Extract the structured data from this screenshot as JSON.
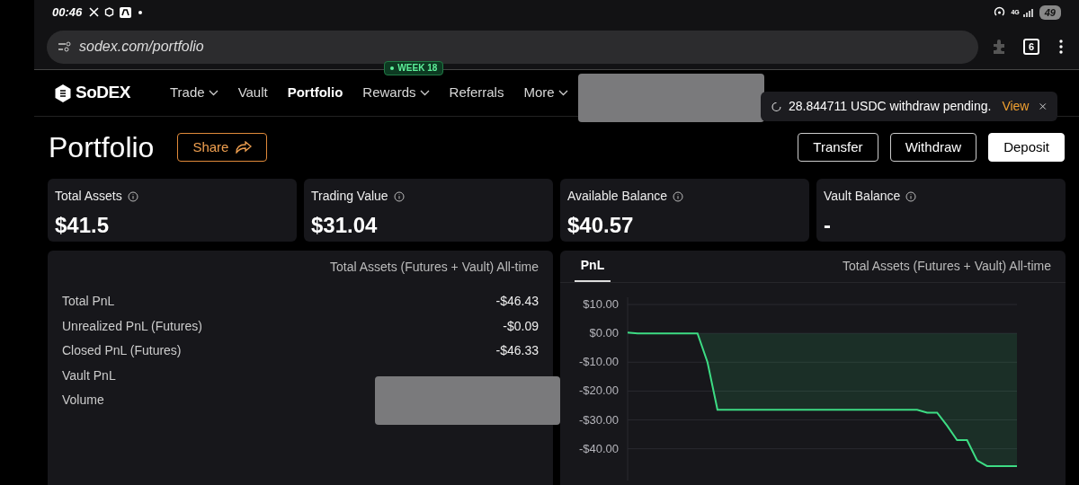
{
  "status_bar": {
    "time": "00:46",
    "network": "4G",
    "battery": "49"
  },
  "browser": {
    "url": "sodex.com/portfolio",
    "tab_count": "6"
  },
  "nav": {
    "logo": "SoDEX",
    "items": [
      {
        "label": "Trade",
        "selected": false,
        "dropdown": true
      },
      {
        "label": "Vault",
        "selected": false,
        "dropdown": false
      },
      {
        "label": "Portfolio",
        "selected": true,
        "dropdown": false
      },
      {
        "label": "Rewards",
        "selected": false,
        "dropdown": true,
        "badge": "WEEK 18"
      },
      {
        "label": "Referrals",
        "selected": false,
        "dropdown": false
      },
      {
        "label": "More",
        "selected": false,
        "dropdown": true
      }
    ]
  },
  "toast": {
    "message": "28.844711 USDC withdraw pending.",
    "action": "View"
  },
  "page": {
    "title": "Portfolio",
    "share": "Share",
    "actions": [
      "Transfer",
      "Withdraw",
      "Deposit"
    ]
  },
  "stats": [
    {
      "label": "Total Assets",
      "value": "$41.5"
    },
    {
      "label": "Trading Value",
      "value": "$31.04"
    },
    {
      "label": "Available Balance",
      "value": "$40.57"
    },
    {
      "label": "Vault Balance",
      "value": "-"
    }
  ],
  "pnl_summary": {
    "scope": "Total Assets (Futures + Vault) All-time",
    "rows": [
      {
        "label": "Total PnL",
        "value": "-$46.43"
      },
      {
        "label": "Unrealized PnL (Futures)",
        "value": "-$0.09"
      },
      {
        "label": "Closed PnL (Futures)",
        "value": "-$46.33"
      },
      {
        "label": "Vault PnL"
      },
      {
        "label": "Volume"
      }
    ]
  },
  "pnl_chart": {
    "tab": "PnL",
    "scope": "Total Assets (Futures + Vault) All-time",
    "chart_data": {
      "type": "area",
      "grid": true,
      "ylim": [
        -51,
        12.5
      ],
      "yticks": [
        {
          "value": 10,
          "label": "$10.00"
        },
        {
          "value": 0,
          "label": "$0.00"
        },
        {
          "value": -10,
          "label": "-$10.00"
        },
        {
          "value": -20,
          "label": "-$20.00"
        },
        {
          "value": -30,
          "label": "-$30.00"
        },
        {
          "value": -40,
          "label": "-$40.00"
        }
      ],
      "series": [
        {
          "color": "#3ddc84",
          "values": [
            0.3,
            0,
            0,
            0,
            0,
            0,
            0,
            0,
            -10,
            -26.5,
            -26.5,
            -26.5,
            -26.5,
            -26.5,
            -26.5,
            -26.5,
            -26.5,
            -26.5,
            -26.5,
            -26.5,
            -26.5,
            -26.5,
            -26.5,
            -26.5,
            -26.5,
            -26.5,
            -26.5,
            -26.5,
            -26.5,
            -26.5,
            -27.5,
            -27.5,
            -32,
            -37,
            -37,
            -44,
            -46,
            -46,
            -46,
            -46
          ]
        }
      ]
    }
  }
}
